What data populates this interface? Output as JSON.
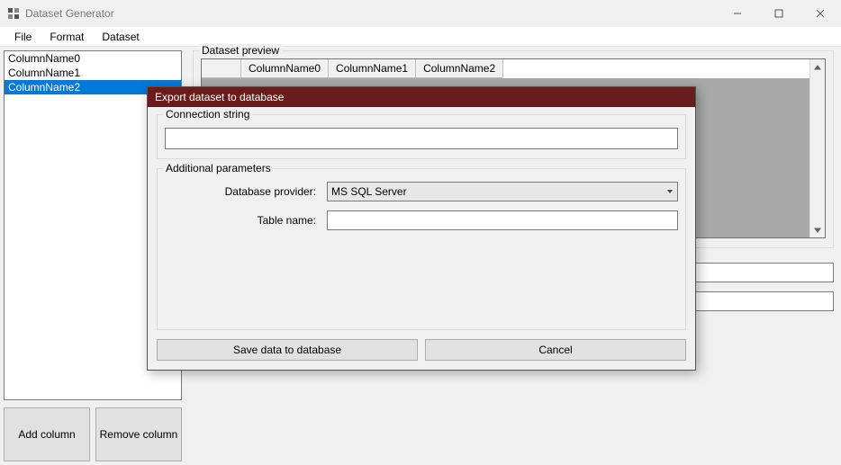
{
  "window": {
    "title": "Dataset Generator"
  },
  "menubar": {
    "file": "File",
    "format": "Format",
    "dataset": "Dataset"
  },
  "sidebar": {
    "items": [
      "ColumnName0",
      "ColumnName1",
      "ColumnName2"
    ],
    "selected_index": 2,
    "add_button": "Add column",
    "remove_button": "Remove column"
  },
  "preview": {
    "legend": "Dataset preview",
    "columns": [
      "ColumnName0",
      "ColumnName1",
      "ColumnName2"
    ]
  },
  "bottom": {
    "field1_value": "",
    "field2_value": ""
  },
  "dialog": {
    "title": "Export dataset to database",
    "connection_legend": "Connection string",
    "connection_value": "",
    "params_legend": "Additional parameters",
    "provider_label": "Database provider:",
    "provider_value": "MS SQL Server",
    "table_label": "Table name:",
    "table_value": "",
    "save_button": "Save data to database",
    "cancel_button": "Cancel"
  }
}
